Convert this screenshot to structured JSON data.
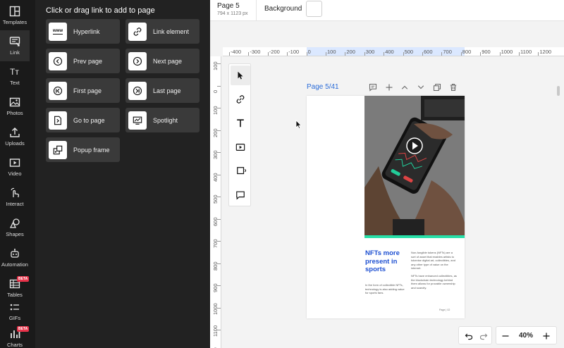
{
  "sidebar": {
    "items": [
      {
        "label": "Templates",
        "icon": "templates-icon"
      },
      {
        "label": "Link",
        "icon": "link-panel-icon",
        "active": true
      },
      {
        "label": "Text",
        "icon": "text-icon"
      },
      {
        "label": "Photos",
        "icon": "photos-icon"
      },
      {
        "label": "Uploads",
        "icon": "uploads-icon"
      },
      {
        "label": "Video",
        "icon": "video-icon"
      },
      {
        "label": "Interact",
        "icon": "interact-icon"
      },
      {
        "label": "Shapes",
        "icon": "shapes-icon"
      },
      {
        "label": "Automation",
        "icon": "automation-icon"
      },
      {
        "label": "Tables",
        "icon": "tables-icon",
        "badge": "BETA"
      },
      {
        "label": "GIFs",
        "icon": "gifs-icon"
      },
      {
        "label": "Charts",
        "icon": "charts-icon",
        "badge": "BETA"
      }
    ]
  },
  "link_panel": {
    "title": "Click or drag link to add to page",
    "tiles": [
      {
        "label": "Hyperlink",
        "icon": "www-icon"
      },
      {
        "label": "Link element",
        "icon": "chain-link-icon"
      },
      {
        "label": "Prev page",
        "icon": "prev-page-icon"
      },
      {
        "label": "Next page",
        "icon": "next-page-icon"
      },
      {
        "label": "First page",
        "icon": "first-page-icon"
      },
      {
        "label": "Last page",
        "icon": "last-page-icon"
      },
      {
        "label": "Go to page",
        "icon": "go-to-page-icon"
      },
      {
        "label": "Spotlight",
        "icon": "spotlight-icon"
      },
      {
        "label": "Popup frame",
        "icon": "popup-frame-icon"
      }
    ],
    "www_glyph": "www"
  },
  "topbar": {
    "page_name": "Page 5",
    "page_size": "794 x 1123 px",
    "background_label": "Background",
    "background_color": "#ffffff"
  },
  "ruler_h": [
    "-400",
    "-300",
    "-200",
    "-100",
    "0",
    "100",
    "200",
    "300",
    "400",
    "500",
    "600",
    "700",
    "800",
    "900",
    "1000",
    "1100",
    "1200"
  ],
  "ruler_v": [
    "100",
    "0",
    "100",
    "200",
    "300",
    "400",
    "500",
    "600",
    "700",
    "800",
    "900",
    "1000",
    "1100",
    "1200"
  ],
  "page_header": {
    "label": "Page 5/41"
  },
  "document": {
    "headline": "NFTs more present in sports",
    "left_para": "In the form of collectible NFTs, technology is also adding value for sports fans.",
    "right_para1": "Non-fungible tokens (NFTs) are a sort of asset that enables artists to tokenise digital art, collectibles, and any other type of value on the internet.",
    "right_para2": "NFTs have enhanced collectibles, as the blockchain technology behind them allows for provable ownership and scarcity.",
    "footer": "Page | 02",
    "accent_color": "#28e0a8",
    "headline_color": "#1d4fd1"
  },
  "zoom": {
    "value": "40%"
  }
}
